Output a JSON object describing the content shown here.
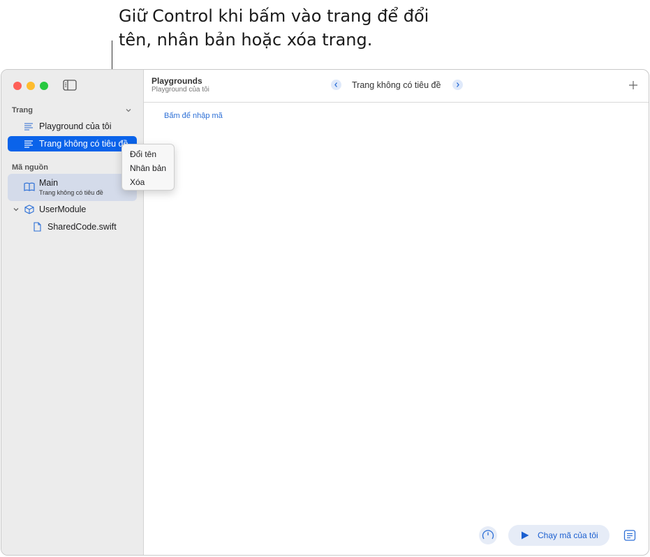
{
  "callout": {
    "text_line1": "Giữ Control khi bấm vào trang để đổi",
    "text_line2": "tên, nhân bản hoặc xóa trang."
  },
  "sidebar": {
    "pages_header": "Trang",
    "pages": [
      {
        "label": "Playground của tôi",
        "icon": "text-lines-icon"
      },
      {
        "label": "Trang không có tiêu đề",
        "icon": "text-lines-icon",
        "selected": true
      }
    ],
    "sources_header": "Mã nguồn",
    "main_item": {
      "label": "Main",
      "sublabel": "Trang không có tiêu đề",
      "icon": "book-icon"
    },
    "module": {
      "label": "UserModule",
      "icon": "cube-icon"
    },
    "file": {
      "label": "SharedCode.swift",
      "icon": "file-icon"
    }
  },
  "toolbar": {
    "title": "Playgrounds",
    "subtitle": "Playground của tôi",
    "page_title": "Trang không có tiêu đề"
  },
  "editor": {
    "placeholder": "Bấm để nhập mã"
  },
  "bottom_bar": {
    "run_label": "Chạy mã của tôi"
  },
  "context_menu": {
    "items": [
      "Đổi tên",
      "Nhân bản",
      "Xóa"
    ]
  },
  "colors": {
    "accent": "#0a63ea",
    "selection_bg": "#d4dbea",
    "traffic_red": "#fe5f57",
    "traffic_yellow": "#febc2e",
    "traffic_green": "#28c840"
  }
}
